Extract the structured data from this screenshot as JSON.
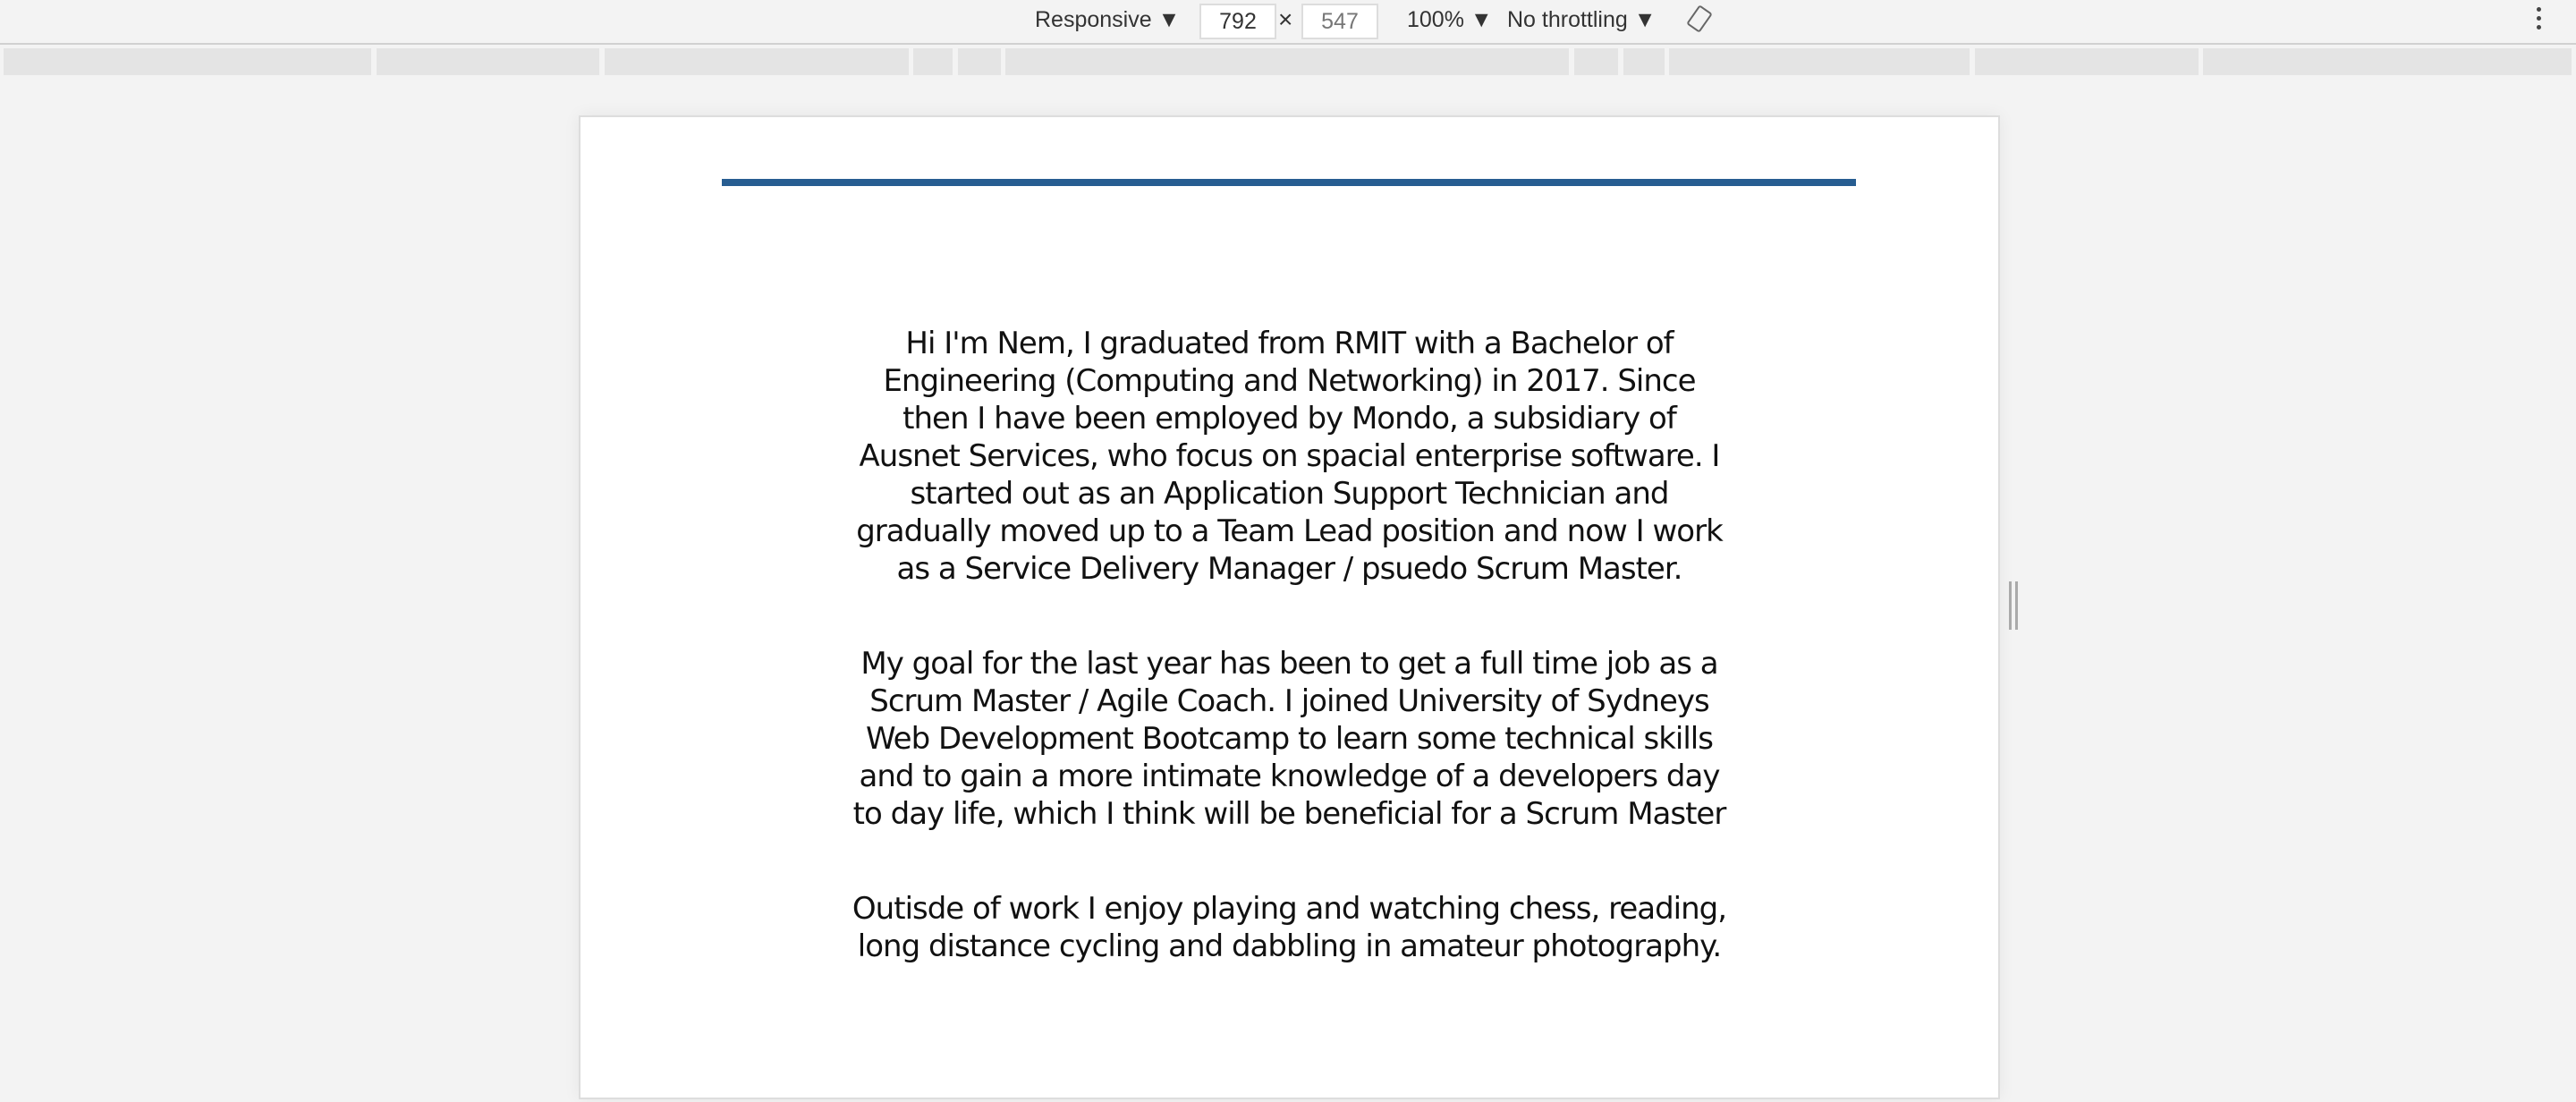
{
  "toolbar": {
    "device": "Responsive ▼",
    "width": "792",
    "times": "×",
    "height": "547",
    "zoom": "100% ▼",
    "throttling": "No throttling ▼",
    "rotate_icon": "rotate-icon",
    "menu_icon": "more-vertical-icon"
  },
  "page": {
    "accent_color": "#275d91",
    "paragraphs": [
      "Hi I'm Nem, I graduated from RMIT with a Bachelor of Engineering (Computing and Networking) in 2017. Since then I have been employed by Mondo, a subsidiary of Ausnet Services, who focus on spacial enterprise software. I started out as an Application Support Technician and gradually moved up to a Team Lead position and now I work as a Service Delivery Manager / psuedo Scrum Master.",
      "My goal for the last year has been to get a full time job as a Scrum Master / Agile Coach. I joined University of Sydneys Web Development Bootcamp to learn some technical skills and to gain a more intimate knowledge of a developers day to day life, which I think will be beneficial for a Scrum Master",
      "Outisde of work I enjoy playing and watching chess, reading, long distance cycling and dabbling in amateur photography."
    ]
  }
}
